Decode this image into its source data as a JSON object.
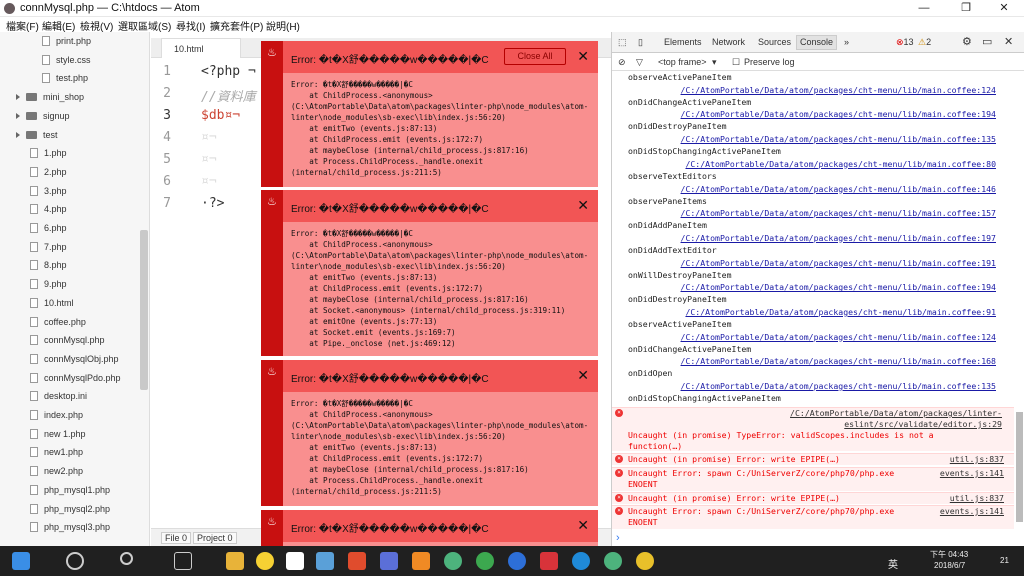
{
  "window": {
    "title": "connMysql.php — C:\\htdocs — Atom",
    "min": "—",
    "max": "❐",
    "close": "✕"
  },
  "menu": [
    "檔案(F)",
    "編輯(E)",
    "檢視(V)",
    "選取區域(S)",
    "尋找(I)",
    "擴充套件(P)",
    "說明(H)"
  ],
  "tree": [
    {
      "label": "print.php",
      "type": "file"
    },
    {
      "label": "style.css",
      "type": "file"
    },
    {
      "label": "test.php",
      "type": "file"
    },
    {
      "label": "mini_shop",
      "type": "folder"
    },
    {
      "label": "signup",
      "type": "folder"
    },
    {
      "label": "test",
      "type": "folder"
    },
    {
      "label": "1.php",
      "type": "file"
    },
    {
      "label": "2.php",
      "type": "file"
    },
    {
      "label": "3.php",
      "type": "file"
    },
    {
      "label": "4.php",
      "type": "file"
    },
    {
      "label": "6.php",
      "type": "file"
    },
    {
      "label": "7.php",
      "type": "file"
    },
    {
      "label": "8.php",
      "type": "file"
    },
    {
      "label": "9.php",
      "type": "file"
    },
    {
      "label": "10.html",
      "type": "file"
    },
    {
      "label": "coffee.php",
      "type": "file"
    },
    {
      "label": "connMysql.php",
      "type": "file"
    },
    {
      "label": "connMysqlObj.php",
      "type": "file"
    },
    {
      "label": "connMysqlPdo.php",
      "type": "file"
    },
    {
      "label": "desktop.ini",
      "type": "file"
    },
    {
      "label": "index.php",
      "type": "file"
    },
    {
      "label": "new 1.php",
      "type": "file"
    },
    {
      "label": "new1.php",
      "type": "file"
    },
    {
      "label": "new2.php",
      "type": "file"
    },
    {
      "label": "php_mysql1.php",
      "type": "file"
    },
    {
      "label": "php_mysql2.php",
      "type": "file"
    },
    {
      "label": "php_mysql3.php",
      "type": "file"
    }
  ],
  "tab": "10.html",
  "code": [
    {
      "n": "1",
      "t": "<?php ¬"
    },
    {
      "n": "2",
      "t": "//資料庫"
    },
    {
      "n": "3",
      "t": "$db¤¬"
    },
    {
      "n": "4",
      "t": "¤¬"
    },
    {
      "n": "5",
      "t": "¤¬"
    },
    {
      "n": "6",
      "t": "¤¬"
    },
    {
      "n": "7",
      "t": "·?>"
    }
  ],
  "status": {
    "file": "File 0",
    "project": "Project 0"
  },
  "errors": [
    {
      "title": "Error: �t�X舒�����w�����|�C",
      "close_all": "Close All",
      "close": "✕",
      "body": "Error: �t�X舒�����w�����|�C\n    at ChildProcess.<anonymous> (C:\\AtomPortable\\Data\\atom\\packages\\linter-php\\node_modules\\atom-linter\\node_modules\\sb-exec\\lib\\index.js:56:20)\n    at emitTwo (events.js:87:13)\n    at ChildProcess.emit (events.js:172:7)\n    at maybeClose (internal/child_process.js:817:16)\n    at Process.ChildProcess._handle.onexit (internal/child_process.js:211:5)"
    },
    {
      "title": "Error: �t�X舒�����w�����|�C",
      "close": "✕",
      "body": "Error: �t�X舒�����w�����|�C\n    at ChildProcess.<anonymous> (C:\\AtomPortable\\Data\\atom\\packages\\linter-php\\node_modules\\atom-linter\\node_modules\\sb-exec\\lib\\index.js:56:20)\n    at emitTwo (events.js:87:13)\n    at ChildProcess.emit (events.js:172:7)\n    at maybeClose (internal/child_process.js:817:16)\n    at Socket.<anonymous> (internal/child_process.js:319:11)\n    at emitOne (events.js:77:13)\n    at Socket.emit (events.js:169:7)\n    at Pipe._onclose (net.js:469:12)"
    },
    {
      "title": "Error: �t�X舒�����w�����|�C",
      "close": "✕",
      "body": "Error: �t�X舒�����w�����|�C\n    at ChildProcess.<anonymous> (C:\\AtomPortable\\Data\\atom\\packages\\linter-php\\node_modules\\atom-linter\\node_modules\\sb-exec\\lib\\index.js:56:20)\n    at emitTwo (events.js:87:13)\n    at ChildProcess.emit (events.js:172:7)\n    at maybeClose (internal/child_process.js:817:16)\n    at Process.ChildProcess._handle.onexit (internal/child_process.js:211:5)"
    },
    {
      "title": "Error: �t�X舒�����w�����|�C",
      "close": "✕",
      "body": ""
    }
  ],
  "devtools": {
    "tabs": [
      "Elements",
      "Network",
      "Sources",
      "Console",
      "»"
    ],
    "errors_count": "13",
    "warn_count": "2",
    "frame": "<top frame>",
    "preserve": "Preserve log"
  },
  "console": [
    {
      "kind": "log",
      "msg": "observeActivePaneItem",
      "link": ""
    },
    {
      "kind": "log",
      "msg": "onDidChangeActivePaneItem",
      "link": "/C:/AtomPortable/Data/atom/packages/cht-menu/lib/main.coffee:124"
    },
    {
      "kind": "log",
      "msg": "onDidDestroyPaneItem",
      "link": "/C:/AtomPortable/Data/atom/packages/cht-menu/lib/main.coffee:194"
    },
    {
      "kind": "log",
      "msg": "onDidStopChangingActivePaneItem",
      "link": "/C:/AtomPortable/Data/atom/packages/cht-menu/lib/main.coffee:135"
    },
    {
      "kind": "log",
      "msg": "observeTextEditors",
      "link": "/C:/AtomPortable/Data/atom/packages/cht-menu/lib/main.coffee:80"
    },
    {
      "kind": "log",
      "msg": "observePaneItems",
      "link": "/C:/AtomPortable/Data/atom/packages/cht-menu/lib/main.coffee:146"
    },
    {
      "kind": "log",
      "msg": "onDidAddPaneItem",
      "link": "/C:/AtomPortable/Data/atom/packages/cht-menu/lib/main.coffee:157"
    },
    {
      "kind": "log",
      "msg": "onDidAddTextEditor",
      "link": "/C:/AtomPortable/Data/atom/packages/cht-menu/lib/main.coffee:197"
    },
    {
      "kind": "log",
      "msg": "onWillDestroyPaneItem",
      "link": "/C:/AtomPortable/Data/atom/packages/cht-menu/lib/main.coffee:191"
    },
    {
      "kind": "log",
      "msg": "onDidDestroyPaneItem",
      "link": "/C:/AtomPortable/Data/atom/packages/cht-menu/lib/main.coffee:194"
    },
    {
      "kind": "log",
      "msg": "observeActivePaneItem",
      "link": "/C:/AtomPortable/Data/atom/packages/cht-menu/lib/main.coffee:91"
    },
    {
      "kind": "log",
      "msg": "onDidChangeActivePaneItem",
      "link": "/C:/AtomPortable/Data/atom/packages/cht-menu/lib/main.coffee:124"
    },
    {
      "kind": "log",
      "msg": "onDidOpen",
      "link": "/C:/AtomPortable/Data/atom/packages/cht-menu/lib/main.coffee:168"
    },
    {
      "kind": "log",
      "msg": "onDidStopChangingActivePaneItem",
      "link": "/C:/AtomPortable/Data/atom/packages/cht-menu/lib/main.coffee:135"
    }
  ],
  "console_errors": [
    {
      "link": "/C:/AtomPortable/Data/atom/packages/linter-eslint/src/validate/editor.js:29",
      "msg": "Uncaught (in promise) TypeError: validScopes.includes is not a\nfunction(…)"
    },
    {
      "link": "util.js:837",
      "msg": "Uncaught (in promise) Error: write EPIPE(…)"
    },
    {
      "link": "events.js:141",
      "msg": "Uncaught Error: spawn C:/UniServerZ/core/php70/php.exe\nENOENT"
    },
    {
      "link": "util.js:837",
      "msg": "Uncaught (in promise) Error: write EPIPE(…)"
    },
    {
      "link": "events.js:141",
      "msg": "Uncaught Error: spawn C:/UniServerZ/core/php70/php.exe\nENOENT"
    }
  ],
  "taskbar": {
    "time": "下午 04:43",
    "date": "2018/6/7",
    "ime": "英",
    "notif": "21"
  }
}
